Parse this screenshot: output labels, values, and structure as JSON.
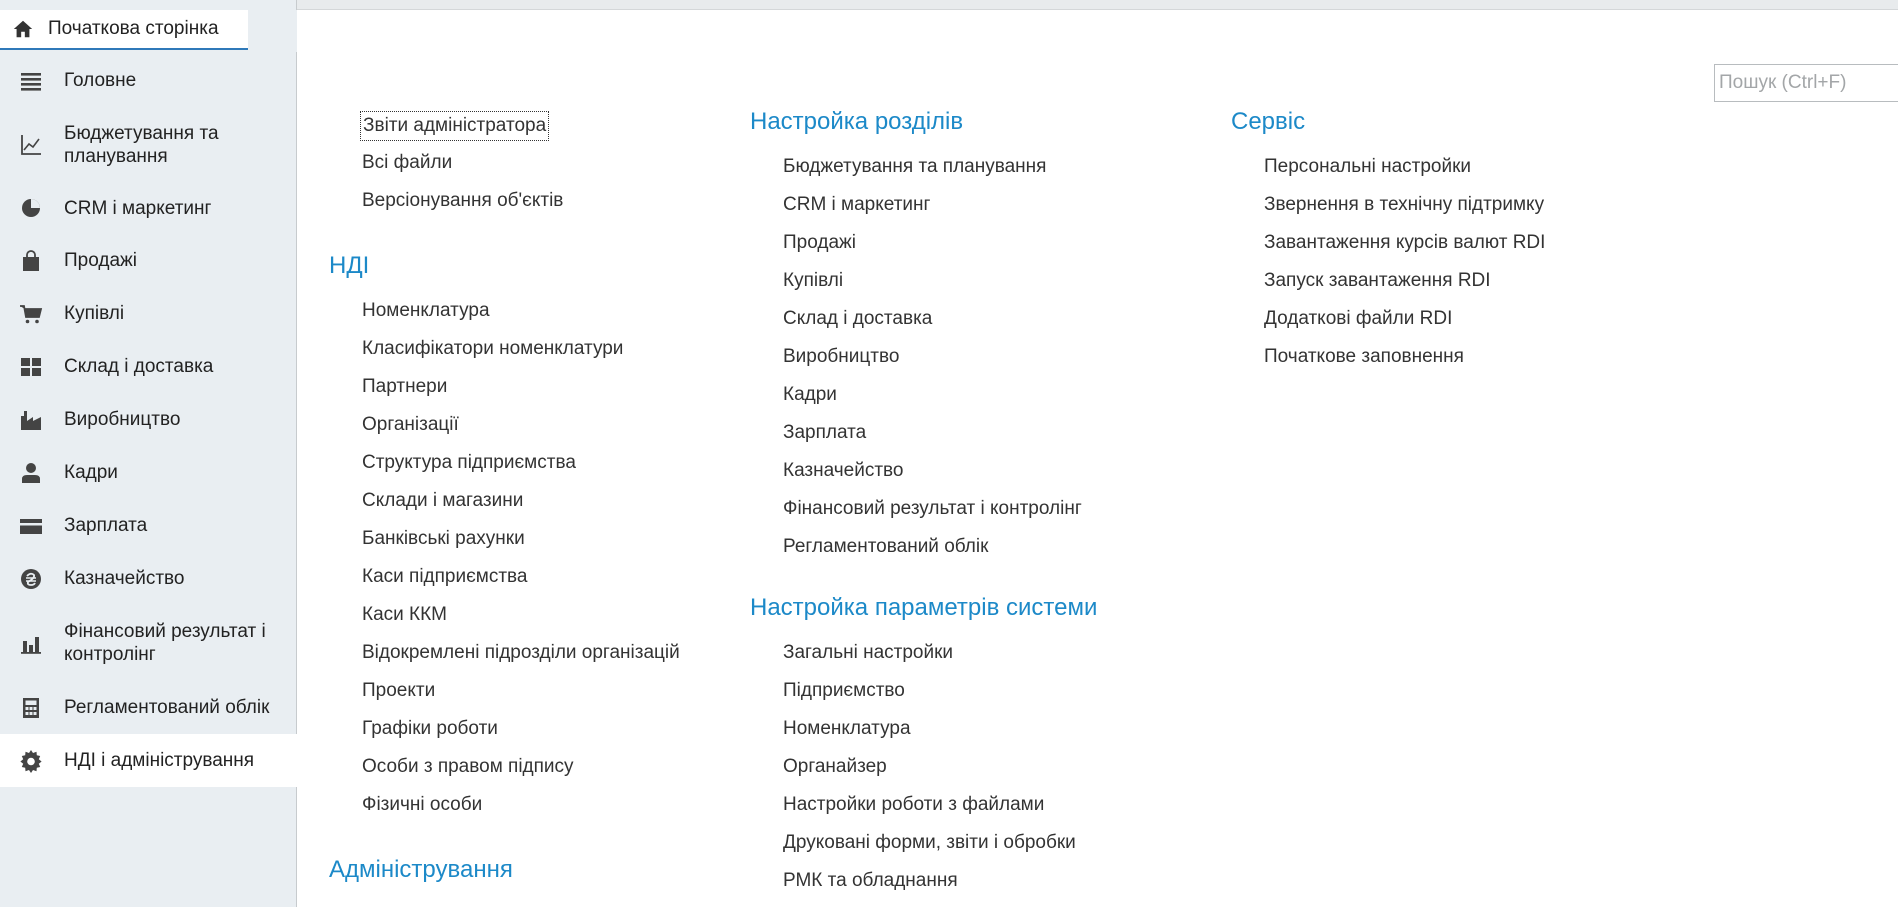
{
  "home_tab": {
    "label": "Початкова сторінка"
  },
  "sidebar": {
    "items": [
      {
        "label": "Головне",
        "icon": "menu-lines-icon"
      },
      {
        "label": "Бюджетування та планування",
        "icon": "chart-axis-icon"
      },
      {
        "label": "CRM і маркетинг",
        "icon": "pie-chart-icon"
      },
      {
        "label": "Продажі",
        "icon": "shopping-bag-icon"
      },
      {
        "label": "Купівлі",
        "icon": "cart-icon"
      },
      {
        "label": "Склад і доставка",
        "icon": "warehouse-grid-icon"
      },
      {
        "label": "Виробництво",
        "icon": "factory-icon"
      },
      {
        "label": "Кадри",
        "icon": "person-icon"
      },
      {
        "label": "Зарплата",
        "icon": "wallet-icon"
      },
      {
        "label": "Казначейство",
        "icon": "hryvnia-coin-icon"
      },
      {
        "label": "Фінансовий результат і контролінг",
        "icon": "bar-chart-icon"
      },
      {
        "label": "Регламентований облік",
        "icon": "calculator-icon"
      },
      {
        "label": "НДІ і адміністрування",
        "icon": "gear-icon",
        "active": true
      }
    ]
  },
  "toolbar": {
    "search_placeholder": "Пошук (Ctrl+F)",
    "clear_label": "×",
    "close_label": "×"
  },
  "col1": {
    "top_links": [
      "Звіти адміністратора",
      "Всі файли",
      "Версіонування об'єктів"
    ],
    "ndi_title": "НДІ",
    "ndi_links": [
      "Номенклатура",
      "Класифікатори номенклатури",
      "Партнери",
      "Організації",
      "Структура підприємства",
      "Склади і магазини",
      "Банківські рахунки",
      "Каси підприємства",
      "Каси ККМ",
      "Відокремлені підрозділи організацій",
      "Проекти",
      "Графіки роботи",
      "Особи з правом підпису",
      "Фізичні особи"
    ],
    "admin_title": "Адміністрування"
  },
  "col2": {
    "sections_title": "Настройка розділів",
    "sections_links": [
      "Бюджетування та планування",
      "CRM і маркетинг",
      "Продажі",
      "Купівлі",
      "Склад і доставка",
      "Виробництво",
      "Кадри",
      "Зарплата",
      "Казначейство",
      "Фінансовий результат і контролінг",
      "Регламентований облік"
    ],
    "params_title": "Настройка параметрів системи",
    "params_links": [
      "Загальні настройки",
      "Підприємство",
      "Номенклатура",
      "Органайзер",
      "Настройки роботи з файлами",
      "Друковані форми, звіти і обробки",
      "РМК та обладнання"
    ]
  },
  "col3": {
    "service_title": "Сервіс",
    "service_links": [
      "Персональні настройки",
      "Звернення в технічну підтримку",
      "Завантаження курсів валют RDI",
      "Запуск завантаження RDI",
      "Додаткові файли RDI",
      "Початкове заповнення"
    ]
  },
  "colors": {
    "accent": "#1c89c8",
    "tab_underline": "#2f79b9",
    "sidebar_bg": "#e9eef2"
  }
}
